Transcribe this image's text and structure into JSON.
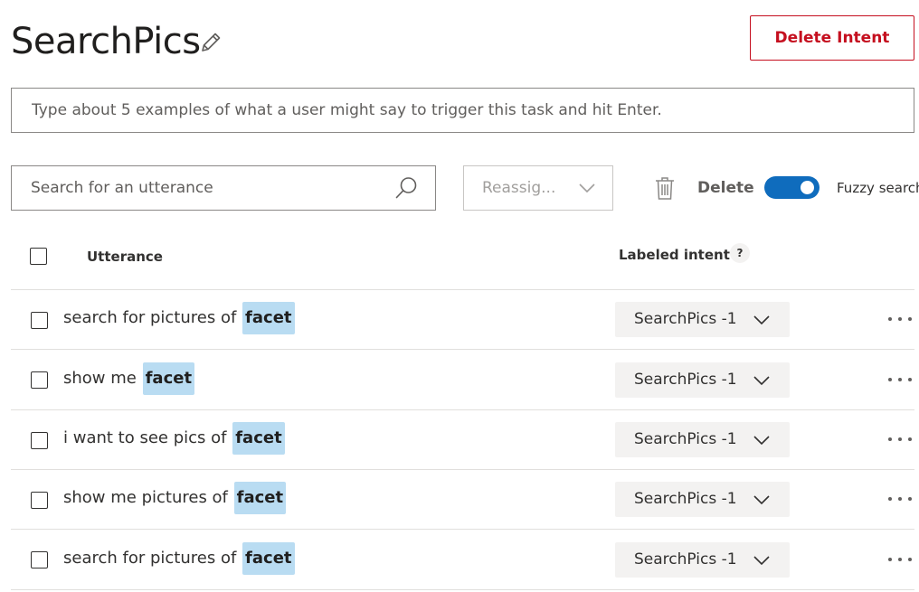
{
  "header": {
    "title": "SearchPics",
    "delete_intent_label": "Delete Intent"
  },
  "example_input": {
    "placeholder": "Type about 5 examples of what a user might say to trigger this task and hit Enter.",
    "value": ""
  },
  "toolbar": {
    "search_placeholder": "Search for an utterance",
    "reassign_label": "Reassig...",
    "delete_label": "Delete",
    "fuzzy_search_label": "Fuzzy search",
    "fuzzy_search_on": true
  },
  "table": {
    "columns": {
      "utterance": "Utterance",
      "labeled_intent": "Labeled intent",
      "help": "?"
    },
    "rows": [
      {
        "text": "search for pictures of",
        "entity": "facet",
        "intent": "SearchPics -1"
      },
      {
        "text": "show me",
        "entity": "facet",
        "intent": "SearchPics -1"
      },
      {
        "text": "i want to see pics of",
        "entity": "facet",
        "intent": "SearchPics -1"
      },
      {
        "text": "show me pictures of",
        "entity": "facet",
        "intent": "SearchPics -1"
      },
      {
        "text": "search for pictures of",
        "entity": "facet",
        "intent": "SearchPics -1"
      }
    ]
  },
  "colors": {
    "danger": "#c50f1f",
    "accent": "#0f6cbd",
    "entity_highlight": "#b9dcf2"
  },
  "icons": [
    "edit-icon",
    "search-icon",
    "chevron-down-icon",
    "trash-icon",
    "more-icon"
  ]
}
